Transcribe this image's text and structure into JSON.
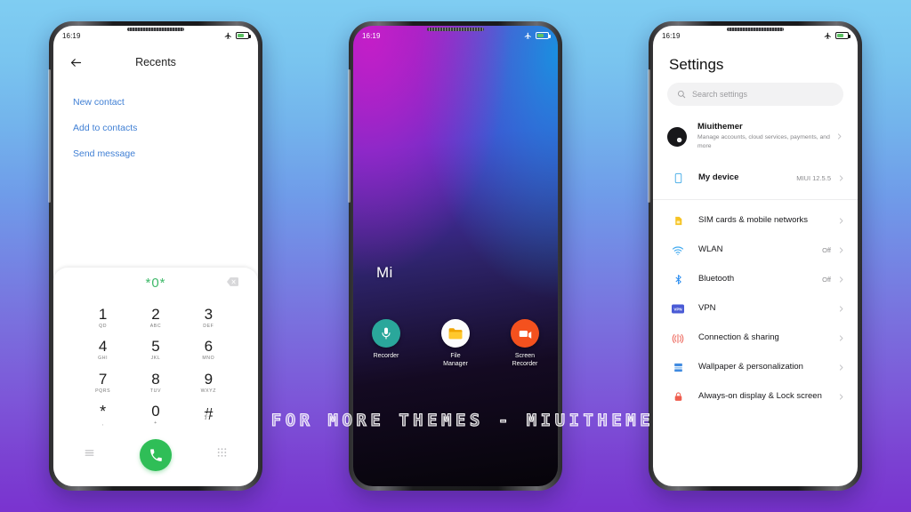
{
  "background": {
    "top_color": "#7fcdf2",
    "bottom_color": "#7a33cf"
  },
  "watermark": {
    "text": "VISIT FOR MORE THEMES - MIUITHEMER.COM"
  },
  "status_bar": {
    "time": "16:19",
    "airplane_icon": "airplane-mode-icon",
    "battery_icon": "battery-icon"
  },
  "phone_dialer": {
    "header": {
      "back_icon": "back-arrow-icon",
      "title": "Recents"
    },
    "links": [
      {
        "label": "New contact"
      },
      {
        "label": "Add to contacts"
      },
      {
        "label": "Send message"
      }
    ],
    "input": {
      "value": "*0*",
      "backspace_icon": "backspace-icon"
    },
    "keys": [
      {
        "digit": "1",
        "sub": "QD"
      },
      {
        "digit": "2",
        "sub": "ABC"
      },
      {
        "digit": "3",
        "sub": "DEF"
      },
      {
        "digit": "4",
        "sub": "GHI"
      },
      {
        "digit": "5",
        "sub": "JKL"
      },
      {
        "digit": "6",
        "sub": "MNO"
      },
      {
        "digit": "7",
        "sub": "PQRS"
      },
      {
        "digit": "8",
        "sub": "TUV"
      },
      {
        "digit": "9",
        "sub": "WXYZ"
      },
      {
        "digit": "*",
        "sub": ","
      },
      {
        "digit": "0",
        "sub": "+"
      },
      {
        "digit": "#",
        "sub": ""
      }
    ],
    "bottom": {
      "menu_icon": "hamburger-menu-icon",
      "call_icon": "call-icon",
      "keypad_icon": "keypad-icon",
      "call_button_color": "#2fbe57"
    },
    "accent_link_color": "#3f7fd4",
    "number_color": "#3fb96a"
  },
  "phone_home": {
    "wallpaper_label": "Mi",
    "apps": [
      {
        "name": "Recorder",
        "icon": "microphone-icon",
        "color": "#2aa79b"
      },
      {
        "name": "File\nManager",
        "name_line1": "File",
        "name_line2": "Manager",
        "icon": "folder-icon",
        "color": "#f5b100"
      },
      {
        "name": "Screen\nRecorder",
        "name_line1": "Screen",
        "name_line2": "Recorder",
        "icon": "video-camera-icon",
        "color": "#f4511e"
      }
    ]
  },
  "phone_settings": {
    "title": "Settings",
    "search": {
      "placeholder": "Search settings",
      "icon": "search-icon"
    },
    "account": {
      "name": "Miuithemer",
      "subtitle": "Manage accounts, cloud services, payments, and more",
      "avatar_icon": "avatar-icon"
    },
    "rows": [
      {
        "label": "My device",
        "value": "MIUI 12.5.5",
        "icon": "device-icon",
        "color": "#4fb0e8"
      },
      {
        "label": "SIM cards & mobile networks",
        "value": "",
        "icon": "sim-card-icon",
        "color": "#f6c324"
      },
      {
        "label": "WLAN",
        "value": "Off",
        "icon": "wifi-icon",
        "color": "#3fa9f0"
      },
      {
        "label": "Bluetooth",
        "value": "Off",
        "icon": "bluetooth-icon",
        "color": "#2f8ff0"
      },
      {
        "label": "VPN",
        "value": "",
        "icon": "vpn-icon",
        "color": "#4a5bd6"
      },
      {
        "label": "Connection & sharing",
        "value": "",
        "icon": "connection-sharing-icon",
        "color": "#ee6d62"
      },
      {
        "label": "Wallpaper & personalization",
        "value": "",
        "icon": "wallpaper-icon",
        "color": "#3f8ae0"
      },
      {
        "label": "Always-on display & Lock screen",
        "value": "",
        "icon": "lock-icon",
        "color": "#ef5d4e"
      }
    ]
  }
}
